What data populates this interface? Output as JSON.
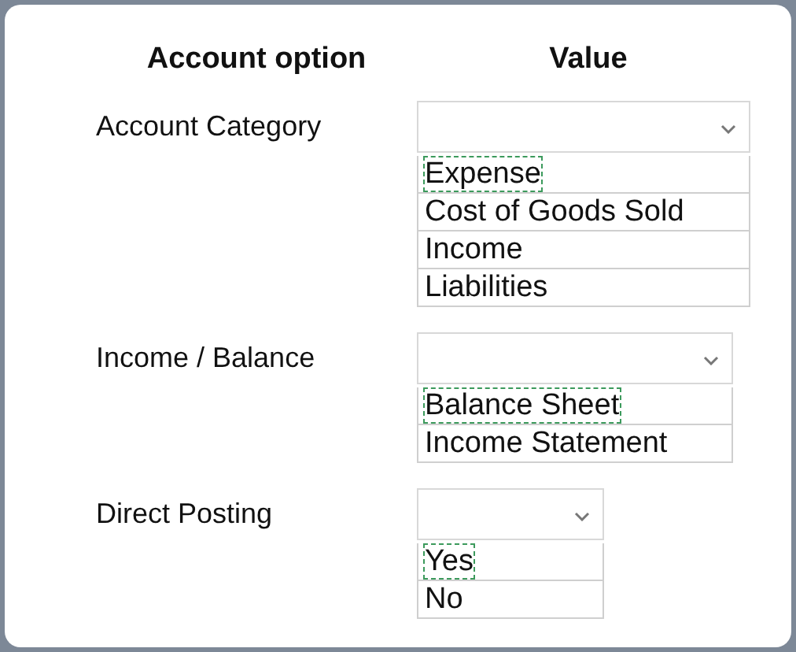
{
  "headers": [
    "Account option",
    "Value"
  ],
  "rows": [
    {
      "label": "Account Category",
      "options": [
        {
          "text": "Expense",
          "selected": true
        },
        {
          "text": "Cost of Goods Sold",
          "selected": false
        },
        {
          "text": "Income",
          "selected": false
        },
        {
          "text": "Liabilities",
          "selected": false
        }
      ]
    },
    {
      "label": "Income / Balance",
      "options": [
        {
          "text": "Balance Sheet",
          "selected": true
        },
        {
          "text": "Income Statement",
          "selected": false
        }
      ]
    },
    {
      "label": "Direct Posting",
      "options": [
        {
          "text": "Yes",
          "selected": true
        },
        {
          "text": "No",
          "selected": false
        }
      ]
    }
  ]
}
